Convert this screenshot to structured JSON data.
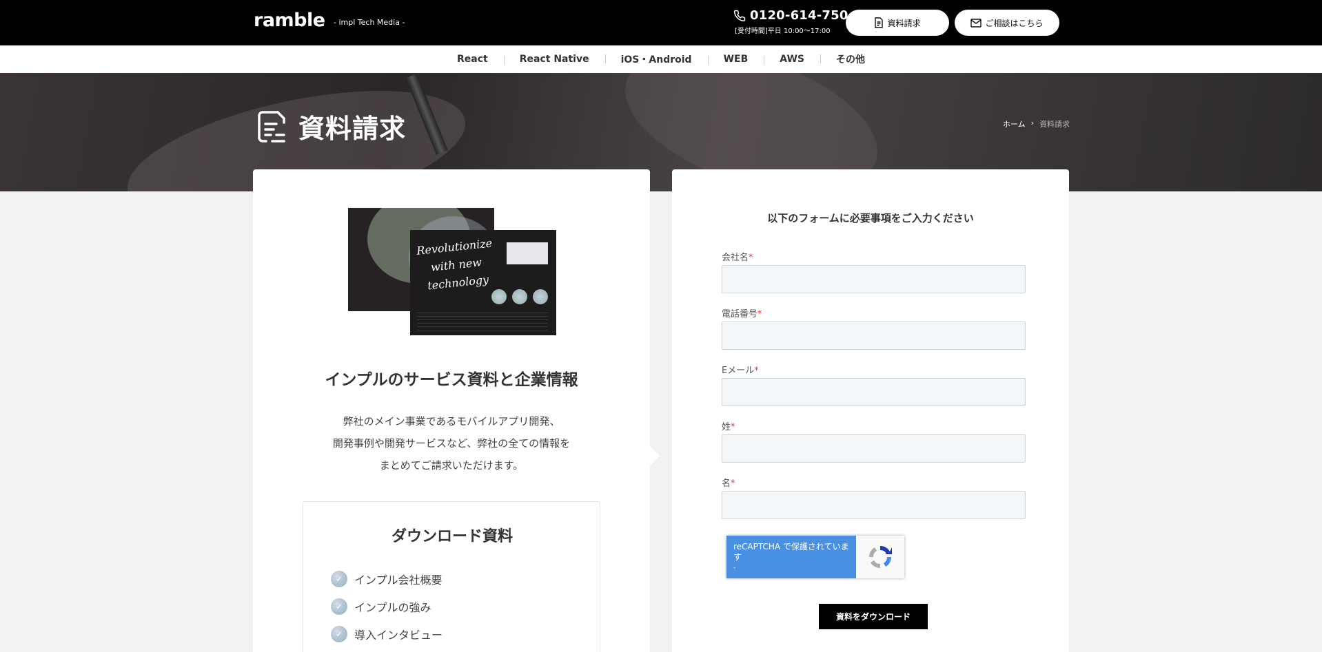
{
  "header": {
    "logo": "ramble",
    "logo_sub": "- impl Tech Media -",
    "phone": "0120-614-750",
    "hours": "[受付時間]平日 10:00〜17:00",
    "doc_button": "資料請求",
    "contact_button": "ご相談はこちら"
  },
  "nav": {
    "items": [
      "React",
      "React Native",
      "iOS・Android",
      "WEB",
      "AWS",
      "その他"
    ]
  },
  "hero": {
    "title": "資料請求",
    "breadcrumb_home": "ホーム",
    "breadcrumb_sep": "›",
    "breadcrumb_current": "資料請求"
  },
  "left": {
    "brochure_text": "Revolutionize with new technology",
    "title": "インプルのサービス資料と企業情報",
    "desc_lines": [
      "弊社のメイン事業であるモバイルアプリ開発、",
      "開発事例や開発サービスなど、弊社の全ての情報を",
      "まとめてご請求いただけます。"
    ],
    "download": {
      "title": "ダウンロード資料",
      "items": [
        "インプル会社概要",
        "インプルの強み",
        "導入インタビュー"
      ]
    }
  },
  "form": {
    "heading": "以下のフォームに必要事項をご入力ください",
    "fields": [
      {
        "label": "会社名",
        "value": ""
      },
      {
        "label": "電話番号",
        "value": ""
      },
      {
        "label": "Eメール",
        "value": ""
      },
      {
        "label": "姓",
        "value": ""
      },
      {
        "label": "名",
        "value": ""
      }
    ],
    "required_mark": "*",
    "recaptcha_text": "reCAPTCHA で保護されています",
    "recaptcha_sub": "-",
    "submit": "資料をダウンロード"
  },
  "colors": {
    "header_bg": "#000000",
    "required": "#e53935",
    "recaptcha_blue": "#4a90e2",
    "input_bg": "#f4f7fa"
  }
}
